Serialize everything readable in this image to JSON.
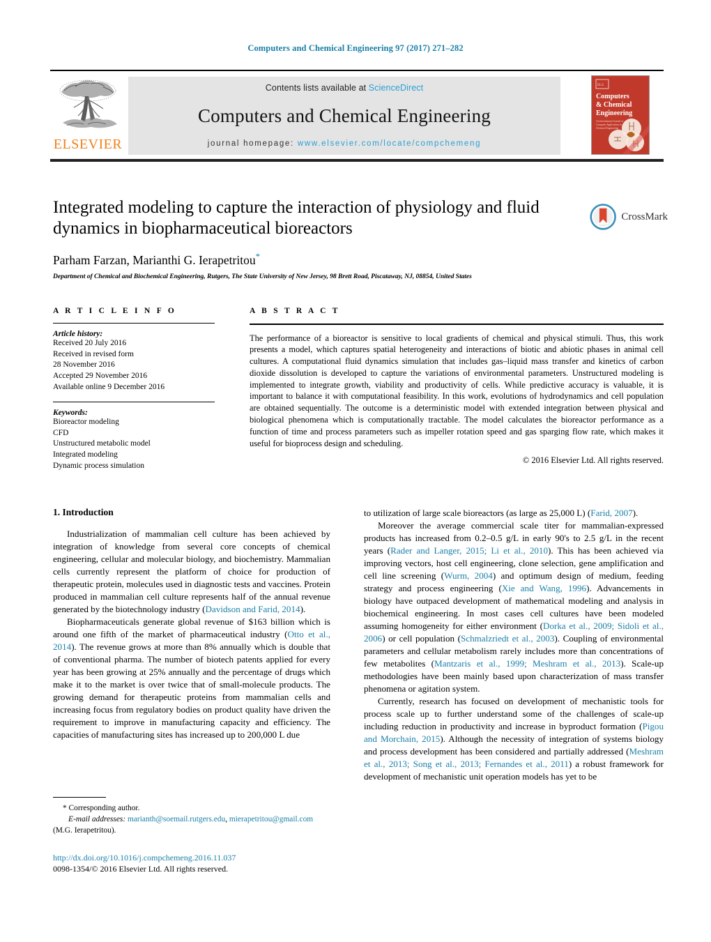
{
  "running_head": "Computers and Chemical Engineering 97 (2017) 271–282",
  "masthead": {
    "publisher": "ELSEVIER",
    "contents_prefix": "Contents lists available at ",
    "contents_link": "ScienceDirect",
    "journal_title": "Computers and Chemical Engineering",
    "homepage_prefix": "journal homepage: ",
    "homepage_url": "www.elsevier.com/locate/compchemeng",
    "cover": {
      "line1": "Computers",
      "line2": "& Chemical",
      "line3": "Engineering",
      "sub1": "An International Journal of",
      "sub2": "Computer Applications in",
      "sub3": "Chemical Engineering"
    }
  },
  "article": {
    "title": "Integrated modeling to capture the interaction of physiology and fluid dynamics in biopharmaceutical bioreactors",
    "authors": "Parham Farzan, Marianthi G. Ierapetritou",
    "corresponding_marker": "*",
    "affiliation": "Department of Chemical and Biochemical Engineering, Rutgers, The State University of New Jersey, 98 Brett Road, Piscataway, NJ, 08854, United States",
    "crossmark_label": "CrossMark"
  },
  "article_info": {
    "heading": "A R T I C L E   I N F O",
    "history_label": "Article history:",
    "history": [
      "Received 20 July 2016",
      "Received in revised form",
      "28 November 2016",
      "Accepted 29 November 2016",
      "Available online 9 December 2016"
    ],
    "keywords_label": "Keywords:",
    "keywords": [
      "Bioreactor modeling",
      "CFD",
      "Unstructured metabolic model",
      "Integrated modeling",
      "Dynamic process simulation"
    ]
  },
  "abstract": {
    "heading": "A B S T R A C T",
    "text": "The performance of a bioreactor is sensitive to local gradients of chemical and physical stimuli. Thus, this work presents a model, which captures spatial heterogeneity and interactions of biotic and abiotic phases in animal cell cultures. A computational fluid dynamics simulation that includes gas–liquid mass transfer and kinetics of carbon dioxide dissolution is developed to capture the variations of environmental parameters. Unstructured modeling is implemented to integrate growth, viability and productivity of cells. While predictive accuracy is valuable, it is important to balance it with computational feasibility. In this work, evolutions of hydrodynamics and cell population are obtained sequentially. The outcome is a deterministic model with extended integration between physical and biological phenomena which is computationally tractable. The model calculates the bioreactor performance as a function of time and process parameters such as impeller rotation speed and gas sparging flow rate, which makes it useful for bioprocess design and scheduling.",
    "copyright": "© 2016 Elsevier Ltd. All rights reserved."
  },
  "introduction": {
    "heading": "1.  Introduction",
    "left_paragraphs": [
      {
        "segments": [
          {
            "t": "Industrialization of mammalian cell culture has been achieved by integration of knowledge from several core concepts of chemical engineering, cellular and molecular biology, and biochemistry. Mammalian cells currently represent the platform of choice for production of therapeutic protein, molecules used in diagnostic tests and vaccines. Protein produced in mammalian cell culture represents half of the annual revenue generated by the biotechnology industry (",
            "ref": false
          },
          {
            "t": "Davidson and Farid, 2014",
            "ref": true
          },
          {
            "t": ").",
            "ref": false
          }
        ]
      },
      {
        "segments": [
          {
            "t": "Biopharmaceuticals generate global revenue of $163 billion which is around one fifth of the market of pharmaceutical industry (",
            "ref": false
          },
          {
            "t": "Otto et al., 2014",
            "ref": true
          },
          {
            "t": "). The revenue grows at more than 8% annually which is double that of conventional pharma. The number of biotech patents applied for every year has been growing at 25% annually and the percentage of drugs which make it to the market is over twice that of small-molecule products. The growing demand for therapeutic proteins from mammalian cells and increasing focus from regulatory bodies on product quality have driven the requirement to improve in manufacturing capacity and efficiency. The capacities of manufacturing sites has increased up to 200,000 L due",
            "ref": false
          }
        ]
      }
    ],
    "right_paragraphs": [
      {
        "segments": [
          {
            "t": "to utilization of large scale bioreactors (as large as 25,000 L) (",
            "ref": false
          },
          {
            "t": "Farid, 2007",
            "ref": true
          },
          {
            "t": ").",
            "ref": false
          }
        ],
        "indent": false
      },
      {
        "segments": [
          {
            "t": "Moreover the average commercial scale titer for mammalian-expressed products has increased from 0.2–0.5 g/L in early 90's to 2.5 g/L in the recent years (",
            "ref": false
          },
          {
            "t": "Rader and Langer, 2015; Li et al., 2010",
            "ref": true
          },
          {
            "t": "). This has been achieved via improving vectors, host cell engineering, clone selection, gene amplification and cell line screening (",
            "ref": false
          },
          {
            "t": "Wurm, 2004",
            "ref": true
          },
          {
            "t": ") and optimum design of medium, feeding strategy and process engineering (",
            "ref": false
          },
          {
            "t": "Xie and Wang, 1996",
            "ref": true
          },
          {
            "t": "). Advancements in biology have outpaced development of mathematical modeling and analysis in biochemical engineering. In most cases cell cultures have been modeled assuming homogeneity for either environment (",
            "ref": false
          },
          {
            "t": "Dorka et al., 2009; Sidoli et al., 2006",
            "ref": true
          },
          {
            "t": ") or cell population (",
            "ref": false
          },
          {
            "t": "Schmalzriedt et al., 2003",
            "ref": true
          },
          {
            "t": "). Coupling of environmental parameters and cellular metabolism rarely includes more than concentrations of few metabolites (",
            "ref": false
          },
          {
            "t": "Mantzaris et al., 1999; Meshram et al., 2013",
            "ref": true
          },
          {
            "t": "). Scale-up methodologies have been mainly based upon characterization of mass transfer phenomena or agitation system.",
            "ref": false
          }
        ],
        "indent": true
      },
      {
        "segments": [
          {
            "t": "Currently, research has focused on development of mechanistic tools for process scale up to further understand some of the challenges of scale-up including reduction in productivity and increase in byproduct formation (",
            "ref": false
          },
          {
            "t": "Pigou and Morchain, 2015",
            "ref": true
          },
          {
            "t": "). Although the necessity of integration of systems biology and process development has been considered and partially addressed (",
            "ref": false
          },
          {
            "t": "Meshram et al., 2013; Song et al., 2013; Fernandes et al., 2011",
            "ref": true
          },
          {
            "t": ") a robust framework for development of mechanistic unit operation models has yet to be",
            "ref": false
          }
        ],
        "indent": true
      }
    ]
  },
  "footnotes": {
    "corresponding": "* Corresponding author.",
    "email_label": "E-mail addresses:",
    "email1": "marianth@soemail.rutgers.edu",
    "email_sep": ", ",
    "email2": "mierapetritou@gmail.com",
    "email_owner": "(M.G. Ierapetritou).",
    "doi": "http://dx.doi.org/10.1016/j.compchemeng.2016.11.037",
    "issn": "0098-1354/© 2016 Elsevier Ltd. All rights reserved."
  },
  "colors": {
    "link": "#1a7fa8",
    "sciencedirect": "#2b9fd4",
    "elsevier_orange": "#f07f1a",
    "panel_grey": "#e4e4e4"
  }
}
